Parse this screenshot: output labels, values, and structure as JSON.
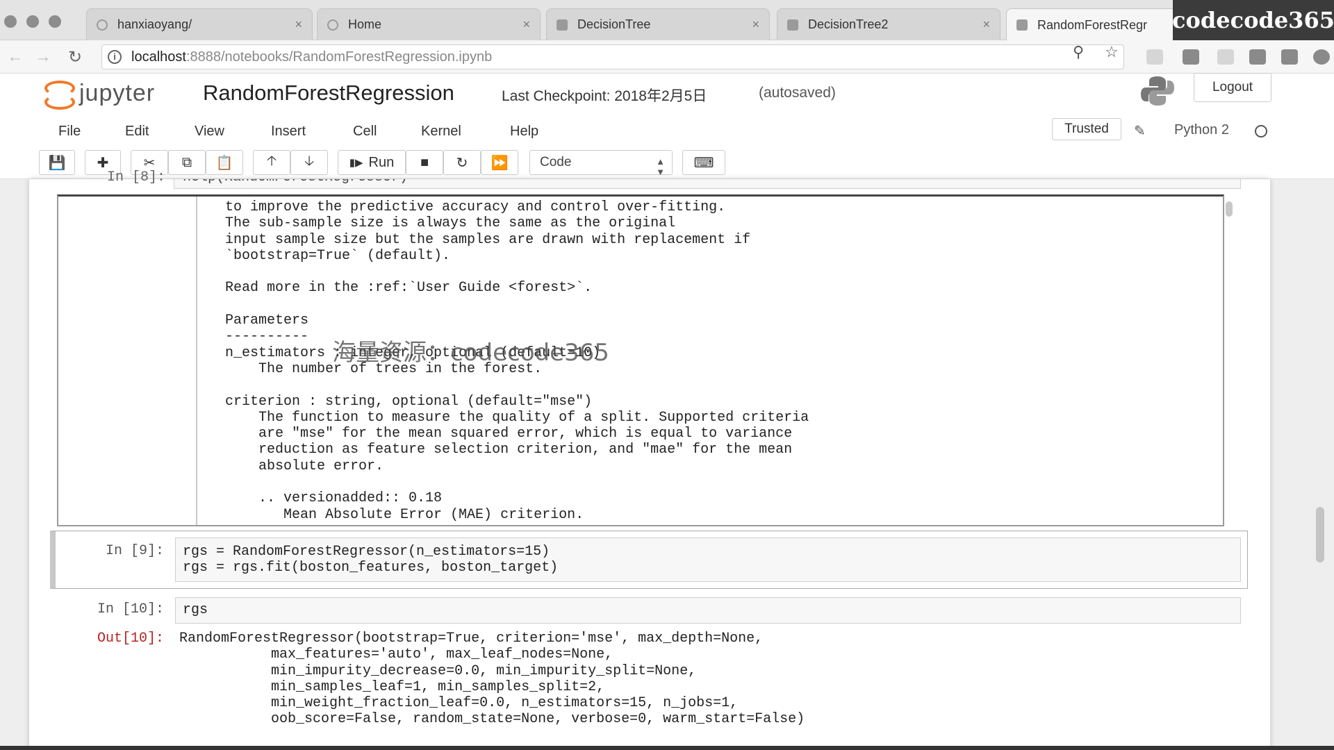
{
  "browser": {
    "tabs": [
      {
        "title": "hanxiaoyang/",
        "close": "×"
      },
      {
        "title": "Home",
        "close": "×"
      },
      {
        "title": "DecisionTree",
        "close": "×"
      },
      {
        "title": "DecisionTree2",
        "close": "×"
      },
      {
        "title": "RandomForestRegr",
        "close": ""
      }
    ],
    "active_tab_index": 4,
    "watermark_badge": "codecode365",
    "url_host": "localhost",
    "url_rest": ":8888/notebooks/RandomForestRegression.ipynb"
  },
  "jupyter": {
    "logo_text": "jupyter",
    "notebook_title": "RandomForestRegression",
    "checkpoint": "Last Checkpoint: 2018年2月5日",
    "autosave": "(autosaved)",
    "logout_label": "Logout",
    "menu": [
      "File",
      "Edit",
      "View",
      "Insert",
      "Cell",
      "Kernel",
      "Help"
    ],
    "trusted_label": "Trusted",
    "kernel_name": "Python 2",
    "toolbar": {
      "run_label": "Run",
      "cell_type": "Code"
    }
  },
  "notebook": {
    "cut_cell": {
      "prompt": "In [8]:",
      "code": "help(RandomForestRegressor)"
    },
    "pager_text": "to improve the predictive accuracy and control over-fitting.\nThe sub-sample size is always the same as the original\ninput sample size but the samples are drawn with replacement if\n`bootstrap=True` (default).\n\nRead more in the :ref:`User Guide <forest>`.\n\nParameters\n----------\nn_estimators : integer, optional (default=10)\n    The number of trees in the forest.\n\ncriterion : string, optional (default=\"mse\")\n    The function to measure the quality of a split. Supported criteria\n    are \"mse\" for the mean squared error, which is equal to variance\n    reduction as feature selection criterion, and \"mae\" for the mean\n    absolute error.\n\n    .. versionadded:: 0.18\n       Mean Absolute Error (MAE) criterion.",
    "watermark": "海量资源：codecode365",
    "cell9": {
      "prompt": "In [9]:",
      "code": "rgs = RandomForestRegressor(n_estimators=15)\nrgs = rgs.fit(boston_features, boston_target)"
    },
    "cell10": {
      "prompt": "In [10]:",
      "code": "rgs",
      "out_prompt": "Out[10]:",
      "output": "RandomForestRegressor(bootstrap=True, criterion='mse', max_depth=None,\n           max_features='auto', max_leaf_nodes=None,\n           min_impurity_decrease=0.0, min_impurity_split=None,\n           min_samples_leaf=1, min_samples_split=2,\n           min_weight_fraction_leaf=0.0, n_estimators=15, n_jobs=1,\n           oob_score=False, random_state=None, verbose=0, warm_start=False)"
    }
  },
  "colors": {
    "jupyter_orange": "#f37726",
    "out_prompt": "#bb2222"
  }
}
